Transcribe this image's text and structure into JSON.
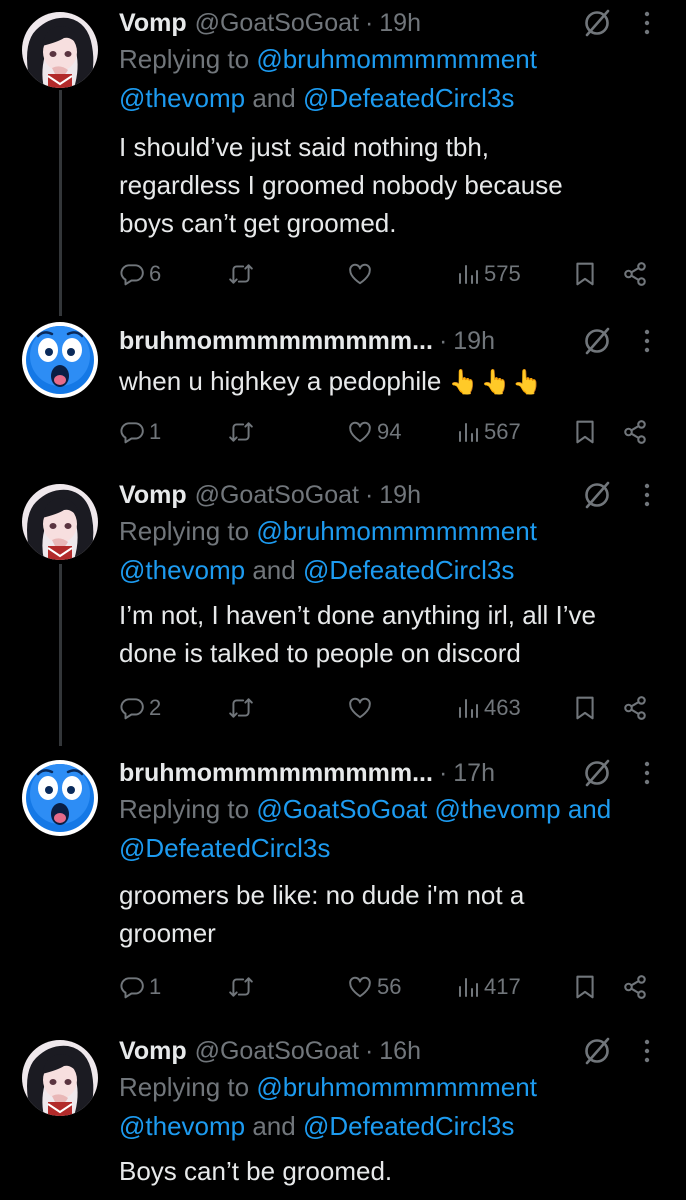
{
  "tweets": [
    {
      "name": "Vomp",
      "handle": "@GoatSoGoat",
      "dot": "·",
      "time": "19h",
      "reply_prefix": "Replying to",
      "reply_line1": "@bruhmommmmmment",
      "reply_line2a": "@thevomp",
      "reply_and": " and ",
      "reply_line2b": "@DefeatedCircl3s",
      "text_lines": [
        "I should’ve just said nothing tbh,",
        "regardless I groomed nobody because",
        "boys can’t get groomed."
      ],
      "replies": "6",
      "reposts": "",
      "likes": "",
      "views": "575"
    },
    {
      "name": "bruhmommmmmmmmm...",
      "dot": "·",
      "time": "19h",
      "text": "when u highkey a pedophile",
      "emoji": "👆👆👆",
      "replies": "1",
      "reposts": "",
      "likes": "94",
      "views": "567"
    },
    {
      "name": "Vomp",
      "handle": "@GoatSoGoat",
      "dot": "·",
      "time": "19h",
      "reply_prefix": "Replying to",
      "reply_line1": "@bruhmommmmmment",
      "reply_line2a": "@thevomp",
      "reply_and": " and ",
      "reply_line2b": "@DefeatedCircl3s",
      "text_lines": [
        "I’m not, I haven’t done anything irl, all I’ve",
        "done is talked to people on discord"
      ],
      "replies": "2",
      "reposts": "",
      "likes": "",
      "views": "463"
    },
    {
      "name": "bruhmommmmmmmmm...",
      "dot": "·",
      "time": "17h",
      "reply_prefix": "Replying to",
      "reply_line1a": "@GoatSoGoat",
      "reply_line1b": "@thevomp",
      "reply_and": " and",
      "reply_line2": "@DefeatedCircl3s",
      "text_lines": [
        "groomers be like: no dude i'm not a",
        "groomer"
      ],
      "replies": "1",
      "reposts": "",
      "likes": "56",
      "views": "417"
    },
    {
      "name": "Vomp",
      "handle": "@GoatSoGoat",
      "dot": "·",
      "time": "16h",
      "reply_prefix": "Replying to",
      "reply_line1": "@bruhmommmmmment",
      "reply_line2a": "@thevomp",
      "reply_and": " and ",
      "reply_line2b": "@DefeatedCircl3s",
      "text_lines": [
        "Boys can’t be groomed."
      ]
    }
  ],
  "icons": {
    "reply": "reply-icon",
    "repost": "repost-icon",
    "like": "heart-icon",
    "views": "views-icon",
    "bookmark": "bookmark-icon",
    "share": "share-icon",
    "grok": "grok-icon",
    "more": "more-icon"
  },
  "colors": {
    "background": "#000000",
    "text": "#e7e9ea",
    "muted": "#71767b",
    "link": "#1d9bf0",
    "line": "#333639"
  }
}
